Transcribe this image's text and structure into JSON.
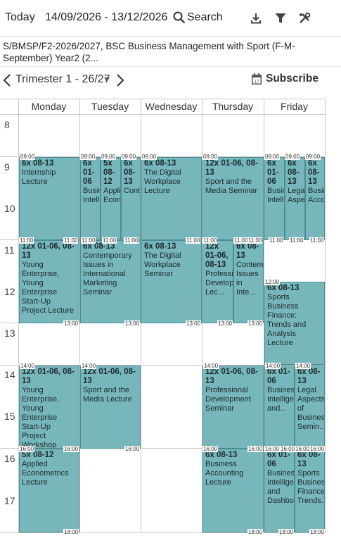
{
  "toolbar": {
    "today_label": "Today",
    "date_range": "14/09/2026 - 13/12/2026",
    "search_label": "Search"
  },
  "course": {
    "text": "S/BMSP/F2-2026/2027, BSC Business Management with Sport (F-M-September) Year2 (2..."
  },
  "nav": {
    "term_label": "Trimester 1 - 26/27",
    "subscribe_label": "Subscribe"
  },
  "days": [
    "Monday",
    "Tuesday",
    "Wednesday",
    "Thursday",
    "Friday"
  ],
  "hours": [
    "8",
    "9",
    "10",
    "11",
    "12",
    "13",
    "14",
    "15",
    "16",
    "17"
  ],
  "events": [
    {
      "l1": "6x 08-13",
      "l2": "Internship Lecture",
      "start": "09:00",
      "end": "11:00"
    },
    {
      "l1": "6x 01-06",
      "l2": "Business Intellige...",
      "start": "09:00",
      "end": "11:00"
    },
    {
      "l1": "5x 08-12",
      "l2": "Applied Econom...",
      "start": "09:00",
      "end": "11:00"
    },
    {
      "l1": "6x 08-13",
      "l2": "Contemporary...",
      "start": "09:00",
      "end": "11:00"
    },
    {
      "l1": "6x 08-13",
      "l2": "The Digital Workplace Lecture",
      "start": "09:00",
      "end": "11:00"
    },
    {
      "l1": "12x 01-06, 08-13",
      "l2": "Sport and the Media Seminar",
      "start": "09:00",
      "end": "11:00"
    },
    {
      "l1": "6x 01-06",
      "l2": "Business Intellige...",
      "start": "09:00",
      "end": "11:00"
    },
    {
      "l1": "6x 08-13",
      "l2": "Legal Aspects...",
      "start": "09:00",
      "end": "11:00"
    },
    {
      "l1": "6x 08-13",
      "l2": "Business Accounti...",
      "start": "09:00",
      "end": "11:00"
    },
    {
      "l1": "12x 01-06, 08-13",
      "l2": "Young Enterprise, Young Enterprise Start-Up Project Lecture",
      "start": "11:00",
      "end": "13:00"
    },
    {
      "l1": "6x 08-13",
      "l2": "Contemporary Issues in International Marketing Seminar",
      "start": "11:00",
      "end": "13:00"
    },
    {
      "l1": "6x 08-13",
      "l2": "The Digital Workplace Seminar",
      "start": "11:00",
      "end": "13:00"
    },
    {
      "l1": "12x 01-06, 08-13",
      "l2": "Professional Development Lec...",
      "start": "11:00",
      "end": "13:00"
    },
    {
      "l1": "6x 08-13",
      "l2": "Contemporary Issues in Inte...",
      "start": "11:00",
      "end": "13:00"
    },
    {
      "l1": "6x 08-13",
      "l2": "Sports Business Finance: Trends and Analysis Lecture",
      "start": "12:00",
      "end": ""
    },
    {
      "l1": "12x 01-06, 08-13",
      "l2": "Young Enterprise, Young Enterprise Start-Up Project Workshop",
      "start": "14:00",
      "end": "16:00"
    },
    {
      "l1": "12x 01-06, 08-13",
      "l2": "Sport and the Media Lecture",
      "start": "14:00",
      "end": "16:00"
    },
    {
      "l1": "12x 01-06, 08-13",
      "l2": "Professional Development Seminar",
      "start": "14:00",
      "end": "16:00"
    },
    {
      "l1": "6x 01-06",
      "l2": "Business Intelligence and...",
      "start": "14:00",
      "end": "16:00"
    },
    {
      "l1": "6x 08-13",
      "l2": "Legal Aspects of Business Semin...",
      "start": "14:00",
      "end": "16:00"
    },
    {
      "l1": "5x 08-12",
      "l2": "Applied Econometrics Lecture",
      "start": "16:00",
      "end": "18:00"
    },
    {
      "l1": "6x 08-13",
      "l2": "Business Accounting Lecture",
      "start": "16:00",
      "end": "18:00"
    },
    {
      "l1": "6x 01-06",
      "l2": "Business Intelligence and Dashbo...",
      "start": "16:00",
      "end": "18:00"
    },
    {
      "l1": "6x 08-13",
      "l2": "Sports Business Finance: Trends...",
      "start": "16:00",
      "end": "18:00"
    }
  ],
  "colors": {
    "event_fill": "#77b7bb",
    "event_border": "#4a8e92"
  }
}
